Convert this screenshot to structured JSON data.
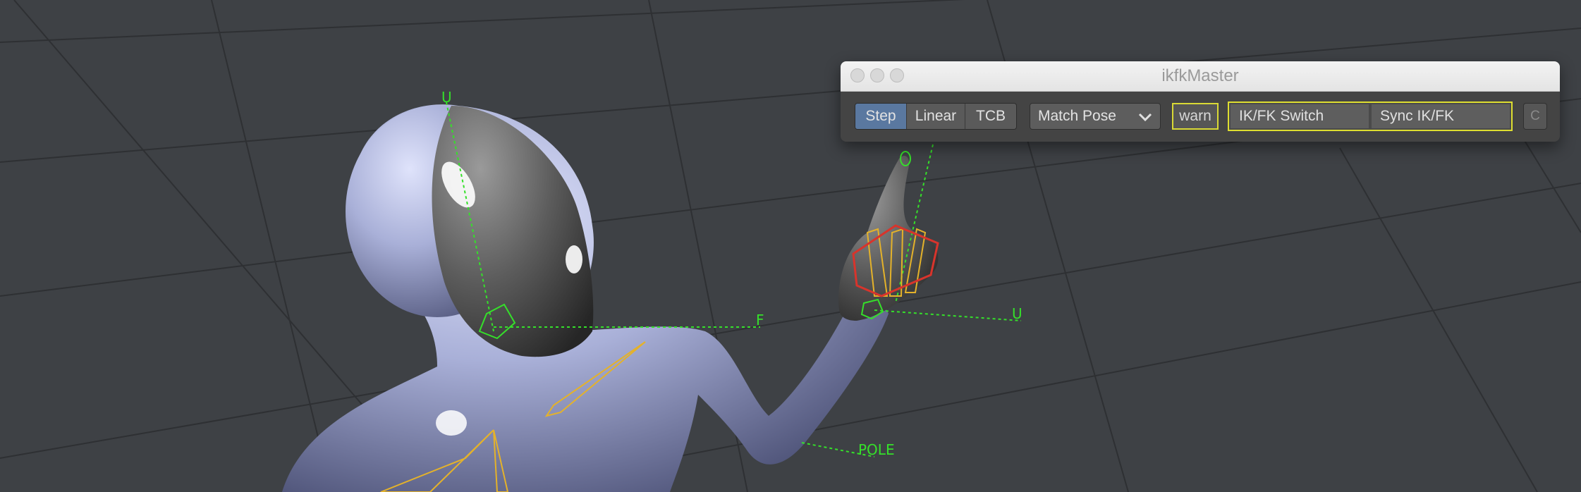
{
  "viewport": {
    "labels": {
      "up_head": "U",
      "forward": "F",
      "up_hand": "U",
      "pole": "POLE"
    },
    "colors": {
      "background": "#3e4145",
      "skin": "#a9b0d8",
      "mask": "#5a5a5a",
      "control": "#35e02a",
      "bone": "#e4b22a",
      "selected": "#d8342c"
    }
  },
  "window": {
    "title": "ikfkMaster",
    "interpolation_tabs": [
      {
        "label": "Step",
        "selected": true
      },
      {
        "label": "Linear",
        "selected": false
      },
      {
        "label": "TCB",
        "selected": false
      }
    ],
    "match_dropdown": {
      "value": "Match Pose"
    },
    "warn_label": "warn",
    "ik_fk_switch_label": "IK/FK Switch",
    "sync_label": "Sync IK/FK",
    "c_label": "C",
    "accent": "#dede30"
  }
}
